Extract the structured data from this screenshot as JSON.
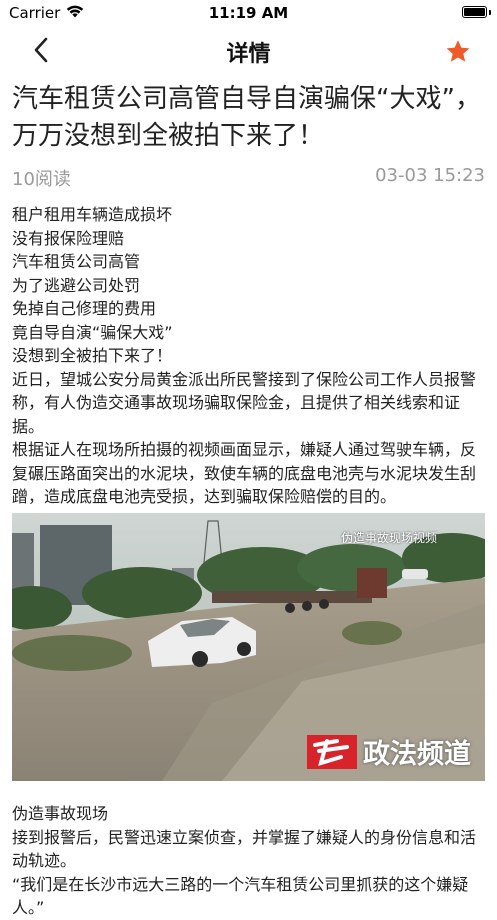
{
  "status_bar": {
    "carrier": "Carrier",
    "time": "11:19 AM",
    "wifi_icon": "wifi-icon",
    "battery_icon": "battery-full-icon"
  },
  "nav": {
    "title": "详情",
    "back_icon": "chevron-left-icon",
    "favorite_icon": "star-icon",
    "favorite_color": "#f05a28"
  },
  "article": {
    "title": "汽车租赁公司高管自导自演骗保“大戏”，万万没想到全被拍下来了！",
    "reads": "10阅读",
    "date": "03-03 15:23",
    "paragraphs": [
      "租户租用车辆造成损坏",
      "没有报保险理赔",
      "汽车租赁公司高管",
      "为了逃避公司处罚",
      "免掉自己修理的费用",
      "竟自导自演“骗保大戏”",
      "没想到全被拍下来了！",
      "近日，望城公安分局黄金派出所民警接到了保险公司工作人员报警称，有人伪造交通事故现场骗取保险金，且提供了相关线索和证据。",
      "根据证人在现场所拍摄的视频画面显示，嫌疑人通过驾驶车辆，反复碾压路面突出的水泥块，致使车辆的底盘电池壳与水泥块发生刮蹭，造成底盘电池壳受损，达到骗取保险赔偿的目的。"
    ],
    "image": {
      "caption_overlay": "伪造事故现场视频",
      "watermark": "政法频道",
      "logo_icon": "channel-logo-icon"
    },
    "after_paragraphs": [
      "伪造事故现场",
      "接到报警后，民警迅速立案侦查，并掌握了嫌疑人的身份信息和活动轨迹。",
      "“我们是在长沙市远大三路的一个汽车租赁公司里抓获的这个嫌疑人。”"
    ]
  }
}
